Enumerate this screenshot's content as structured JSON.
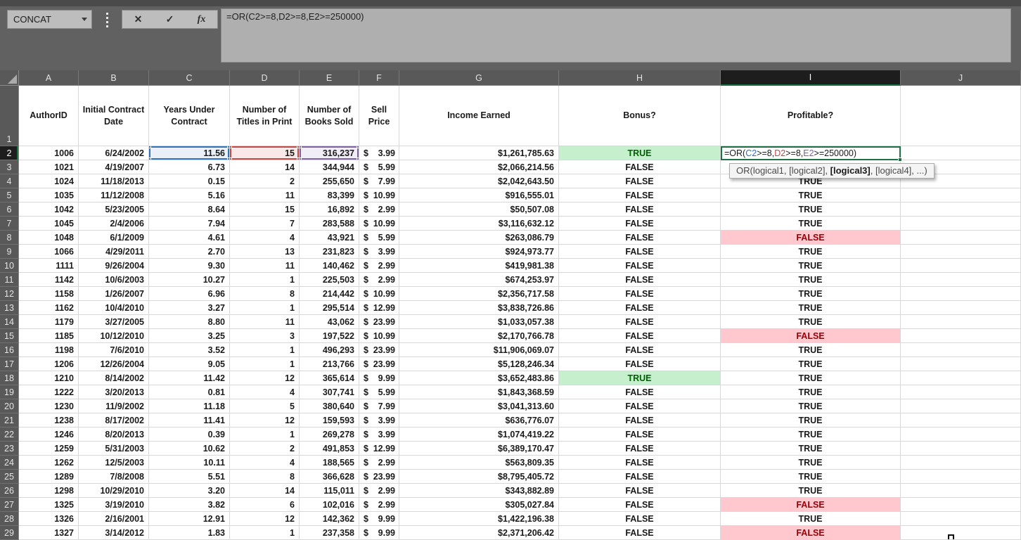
{
  "name_box": {
    "value": "CONCAT"
  },
  "formula_bar": {
    "formula": "=OR(C2>=8,D2>=8,E2>=250000)",
    "cancel_icon": "✕",
    "enter_icon": "✓",
    "fx_icon": "fx"
  },
  "grid": {
    "column_letters": [
      "A",
      "B",
      "C",
      "D",
      "E",
      "F",
      "G",
      "H",
      "I",
      "J"
    ],
    "selected_column": "I",
    "selected_row": 2,
    "header_row_number": "1"
  },
  "table": {
    "currency_symbol": "$",
    "headers": [
      "AuthorID",
      "Initial Contract Date",
      "Years Under Contract",
      "Number of Titles in Print",
      "Number of Books Sold",
      "Sell Price",
      "Income Earned",
      "Bonus?",
      "Profitable?"
    ],
    "rows": [
      {
        "row": 2,
        "author_id": "1006",
        "contract_date": "6/24/2002",
        "years": "11.56",
        "titles": "15",
        "books": "316,237",
        "price": "3.99",
        "income": "$1,261,785.63",
        "bonus": "TRUE",
        "bonus_fill": true,
        "profitable": "",
        "active": true
      },
      {
        "row": 3,
        "author_id": "1021",
        "contract_date": "4/19/2007",
        "years": "6.73",
        "titles": "14",
        "books": "344,944",
        "price": "5.99",
        "income": "$2,066,214.56",
        "bonus": "FALSE",
        "bonus_fill": false,
        "profitable": "TRUE",
        "profitable_fill": false
      },
      {
        "row": 4,
        "author_id": "1024",
        "contract_date": "11/18/2013",
        "years": "0.15",
        "titles": "2",
        "books": "255,650",
        "price": "7.99",
        "income": "$2,042,643.50",
        "bonus": "FALSE",
        "bonus_fill": false,
        "profitable": "TRUE",
        "profitable_fill": false
      },
      {
        "row": 5,
        "author_id": "1035",
        "contract_date": "11/12/2008",
        "years": "5.16",
        "titles": "11",
        "books": "83,399",
        "price": "10.99",
        "income": "$916,555.01",
        "bonus": "FALSE",
        "bonus_fill": false,
        "profitable": "TRUE",
        "profitable_fill": false
      },
      {
        "row": 6,
        "author_id": "1042",
        "contract_date": "5/23/2005",
        "years": "8.64",
        "titles": "15",
        "books": "16,892",
        "price": "2.99",
        "income": "$50,507.08",
        "bonus": "FALSE",
        "bonus_fill": false,
        "profitable": "TRUE",
        "profitable_fill": false
      },
      {
        "row": 7,
        "author_id": "1045",
        "contract_date": "2/4/2006",
        "years": "7.94",
        "titles": "7",
        "books": "283,588",
        "price": "10.99",
        "income": "$3,116,632.12",
        "bonus": "FALSE",
        "bonus_fill": false,
        "profitable": "TRUE",
        "profitable_fill": false
      },
      {
        "row": 8,
        "author_id": "1048",
        "contract_date": "6/1/2009",
        "years": "4.61",
        "titles": "4",
        "books": "43,921",
        "price": "5.99",
        "income": "$263,086.79",
        "bonus": "FALSE",
        "bonus_fill": false,
        "profitable": "FALSE",
        "profitable_fill": true
      },
      {
        "row": 9,
        "author_id": "1066",
        "contract_date": "4/29/2011",
        "years": "2.70",
        "titles": "13",
        "books": "231,823",
        "price": "3.99",
        "income": "$924,973.77",
        "bonus": "FALSE",
        "bonus_fill": false,
        "profitable": "TRUE",
        "profitable_fill": false
      },
      {
        "row": 10,
        "author_id": "1111",
        "contract_date": "9/26/2004",
        "years": "9.30",
        "titles": "11",
        "books": "140,462",
        "price": "2.99",
        "income": "$419,981.38",
        "bonus": "FALSE",
        "bonus_fill": false,
        "profitable": "TRUE",
        "profitable_fill": false
      },
      {
        "row": 11,
        "author_id": "1142",
        "contract_date": "10/6/2003",
        "years": "10.27",
        "titles": "1",
        "books": "225,503",
        "price": "2.99",
        "income": "$674,253.97",
        "bonus": "FALSE",
        "bonus_fill": false,
        "profitable": "TRUE",
        "profitable_fill": false
      },
      {
        "row": 12,
        "author_id": "1158",
        "contract_date": "1/26/2007",
        "years": "6.96",
        "titles": "8",
        "books": "214,442",
        "price": "10.99",
        "income": "$2,356,717.58",
        "bonus": "FALSE",
        "bonus_fill": false,
        "profitable": "TRUE",
        "profitable_fill": false
      },
      {
        "row": 13,
        "author_id": "1162",
        "contract_date": "10/4/2010",
        "years": "3.27",
        "titles": "1",
        "books": "295,514",
        "price": "12.99",
        "income": "$3,838,726.86",
        "bonus": "FALSE",
        "bonus_fill": false,
        "profitable": "TRUE",
        "profitable_fill": false
      },
      {
        "row": 14,
        "author_id": "1179",
        "contract_date": "3/27/2005",
        "years": "8.80",
        "titles": "11",
        "books": "43,062",
        "price": "23.99",
        "income": "$1,033,057.38",
        "bonus": "FALSE",
        "bonus_fill": false,
        "profitable": "TRUE",
        "profitable_fill": false
      },
      {
        "row": 15,
        "author_id": "1185",
        "contract_date": "10/12/2010",
        "years": "3.25",
        "titles": "3",
        "books": "197,522",
        "price": "10.99",
        "income": "$2,170,766.78",
        "bonus": "FALSE",
        "bonus_fill": false,
        "profitable": "FALSE",
        "profitable_fill": true
      },
      {
        "row": 16,
        "author_id": "1198",
        "contract_date": "7/6/2010",
        "years": "3.52",
        "titles": "1",
        "books": "496,293",
        "price": "23.99",
        "income": "$11,906,069.07",
        "bonus": "FALSE",
        "bonus_fill": false,
        "profitable": "TRUE",
        "profitable_fill": false
      },
      {
        "row": 17,
        "author_id": "1206",
        "contract_date": "12/26/2004",
        "years": "9.05",
        "titles": "1",
        "books": "213,766",
        "price": "23.99",
        "income": "$5,128,246.34",
        "bonus": "FALSE",
        "bonus_fill": false,
        "profitable": "TRUE",
        "profitable_fill": false
      },
      {
        "row": 18,
        "author_id": "1210",
        "contract_date": "8/14/2002",
        "years": "11.42",
        "titles": "12",
        "books": "365,614",
        "price": "9.99",
        "income": "$3,652,483.86",
        "bonus": "TRUE",
        "bonus_fill": true,
        "profitable": "TRUE",
        "profitable_fill": false
      },
      {
        "row": 19,
        "author_id": "1222",
        "contract_date": "3/20/2013",
        "years": "0.81",
        "titles": "4",
        "books": "307,741",
        "price": "5.99",
        "income": "$1,843,368.59",
        "bonus": "FALSE",
        "bonus_fill": false,
        "profitable": "TRUE",
        "profitable_fill": false
      },
      {
        "row": 20,
        "author_id": "1230",
        "contract_date": "11/9/2002",
        "years": "11.18",
        "titles": "5",
        "books": "380,640",
        "price": "7.99",
        "income": "$3,041,313.60",
        "bonus": "FALSE",
        "bonus_fill": false,
        "profitable": "TRUE",
        "profitable_fill": false
      },
      {
        "row": 21,
        "author_id": "1238",
        "contract_date": "8/17/2002",
        "years": "11.41",
        "titles": "12",
        "books": "159,593",
        "price": "3.99",
        "income": "$636,776.07",
        "bonus": "FALSE",
        "bonus_fill": false,
        "profitable": "TRUE",
        "profitable_fill": false
      },
      {
        "row": 22,
        "author_id": "1246",
        "contract_date": "8/20/2013",
        "years": "0.39",
        "titles": "1",
        "books": "269,278",
        "price": "3.99",
        "income": "$1,074,419.22",
        "bonus": "FALSE",
        "bonus_fill": false,
        "profitable": "TRUE",
        "profitable_fill": false
      },
      {
        "row": 23,
        "author_id": "1259",
        "contract_date": "5/31/2003",
        "years": "10.62",
        "titles": "2",
        "books": "491,853",
        "price": "12.99",
        "income": "$6,389,170.47",
        "bonus": "FALSE",
        "bonus_fill": false,
        "profitable": "TRUE",
        "profitable_fill": false
      },
      {
        "row": 24,
        "author_id": "1262",
        "contract_date": "12/5/2003",
        "years": "10.11",
        "titles": "4",
        "books": "188,565",
        "price": "2.99",
        "income": "$563,809.35",
        "bonus": "FALSE",
        "bonus_fill": false,
        "profitable": "TRUE",
        "profitable_fill": false
      },
      {
        "row": 25,
        "author_id": "1289",
        "contract_date": "7/8/2008",
        "years": "5.51",
        "titles": "8",
        "books": "366,628",
        "price": "23.99",
        "income": "$8,795,405.72",
        "bonus": "FALSE",
        "bonus_fill": false,
        "profitable": "TRUE",
        "profitable_fill": false
      },
      {
        "row": 26,
        "author_id": "1298",
        "contract_date": "10/29/2010",
        "years": "3.20",
        "titles": "14",
        "books": "115,011",
        "price": "2.99",
        "income": "$343,882.89",
        "bonus": "FALSE",
        "bonus_fill": false,
        "profitable": "TRUE",
        "profitable_fill": false
      },
      {
        "row": 27,
        "author_id": "1325",
        "contract_date": "3/19/2010",
        "years": "3.82",
        "titles": "6",
        "books": "102,016",
        "price": "2.99",
        "income": "$305,027.84",
        "bonus": "FALSE",
        "bonus_fill": false,
        "profitable": "FALSE",
        "profitable_fill": true
      },
      {
        "row": 28,
        "author_id": "1326",
        "contract_date": "2/16/2001",
        "years": "12.91",
        "titles": "12",
        "books": "142,362",
        "price": "9.99",
        "income": "$1,422,196.38",
        "bonus": "FALSE",
        "bonus_fill": false,
        "profitable": "TRUE",
        "profitable_fill": false
      },
      {
        "row": 29,
        "author_id": "1327",
        "contract_date": "3/14/2012",
        "years": "1.83",
        "titles": "1",
        "books": "237,358",
        "price": "9.99",
        "income": "$2,371,206.42",
        "bonus": "FALSE",
        "bonus_fill": false,
        "profitable": "FALSE",
        "profitable_fill": true
      }
    ]
  },
  "active_cell": {
    "ref": "I2",
    "formula_segments": [
      {
        "t": "=OR(",
        "c": "default"
      },
      {
        "t": "C2",
        "c": "blue"
      },
      {
        "t": ">=8,",
        "c": "default"
      },
      {
        "t": "D2",
        "c": "red"
      },
      {
        "t": ">=8,",
        "c": "default"
      },
      {
        "t": "E2",
        "c": "purple"
      },
      {
        "t": ">=250000)",
        "c": "default"
      }
    ]
  },
  "tooltip": {
    "segments": [
      {
        "t": "OR(logical1, [logical2], ",
        "b": false
      },
      {
        "t": "[logical3]",
        "b": true
      },
      {
        "t": ", [logical4], ...)",
        "b": false
      }
    ]
  },
  "colors": {
    "ref_blue": "#2F6FBF",
    "ref_red": "#C64540",
    "ref_purple": "#8B57B8",
    "ref_blue_fill": "#E9F0F8",
    "ref_red_fill": "#F8E8E7",
    "ref_purple_fill": "#F1EDF7",
    "active_green": "#1E7145",
    "true_fill": "#C6EFCE",
    "true_text": "#006100",
    "false_fill": "#FFC7CE",
    "false_text": "#9C0006"
  }
}
